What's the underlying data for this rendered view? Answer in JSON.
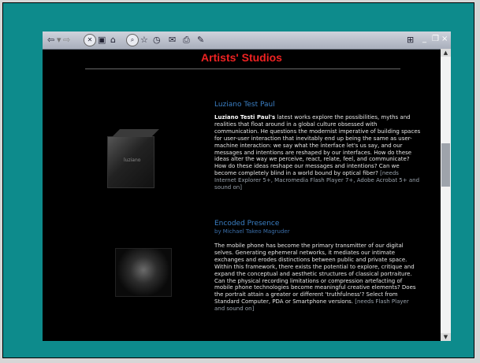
{
  "page_title": "Artists' Studios",
  "toolbar_icons": [
    "back-icon",
    "forward-icon",
    "stop-icon",
    "refresh-icon",
    "home-icon",
    "search-icon",
    "favorites-icon",
    "history-icon",
    "mail-icon",
    "print-icon",
    "edit-icon"
  ],
  "window_controls": {
    "minimize": "_",
    "restore": "❐",
    "close": "×"
  },
  "cube_caption": "luziano",
  "entry1": {
    "heading": "Luziano Test Paul",
    "author": "Luziano Testi Paul's",
    "text": " latest works explore the possibilities, myths and realities that float around in a global culture obsessed with communication. He questions the modernist imperative of building spaces for user-user interaction that inevitably end up being the same as user-machine interaction: we say what the interface let's us say, and our messages and intentions are reshaped by our interfaces. How do these ideas alter the way we perceive, react, relate, feel, and communicate? How do these ideas reshape our messages and intentions? Can we become completely blind in a world bound by optical fiber?",
    "note": " [needs Internet Explorer 5+, Macromedia Flash Player 7+, Adobe Acrobat 5+ and sound on]"
  },
  "entry2": {
    "heading": "Encoded Presence",
    "byline": "by Michael Takeo Magruder",
    "text": "The mobile phone has become the primary transmitter of our digital selves. Generating ephemeral networks, it mediates our intimate exchanges and erodes distinctions between public and private space. Within this framework, there exists the potential to explore, critique and expand the conceptual and aesthetic structures of classical portraiture. Can the physical recording limitations or compression artefacting of mobile phone technologies become meaningful creative elements? Does the portrait attain a greater or different 'truthfulness'? Select from Standard Computer, PDA or Smartphone versions.",
    "note": " [needs Flash Player and sound on]"
  }
}
